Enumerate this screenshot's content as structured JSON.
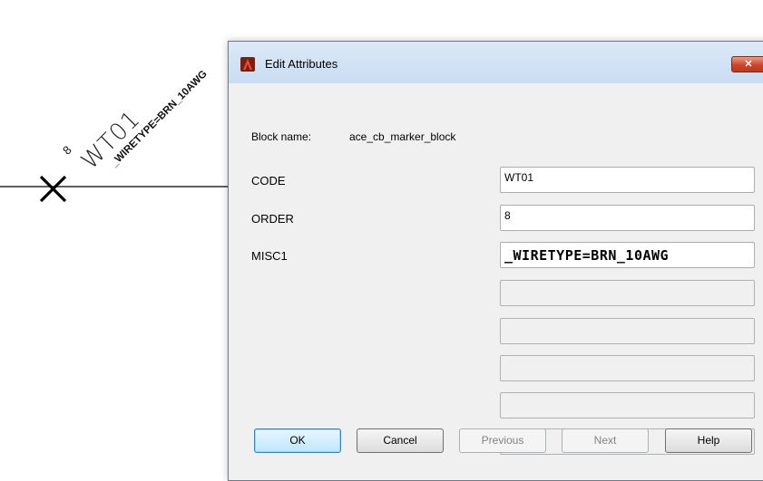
{
  "drawing": {
    "order_text": "8",
    "code_text": "WT01",
    "misc_text": "_WIRETYPE=BRN_10AWG"
  },
  "dialog": {
    "title": "Edit Attributes",
    "close_icon": "close-x-icon",
    "close_glyph": "✕",
    "block_name_label": "Block name:",
    "block_name_value": "ace_cb_marker_block",
    "attributes": [
      {
        "label": "CODE",
        "value": "WT01"
      },
      {
        "label": "ORDER",
        "value": "8"
      },
      {
        "label": "MISC1",
        "value": "_WIRETYPE=BRN_10AWG"
      }
    ],
    "buttons": {
      "ok": "OK",
      "cancel": "Cancel",
      "previous": "Previous",
      "next": "Next",
      "help": "Help"
    },
    "colors": {
      "title_icon": "#c0392b",
      "close_button": "#c9452b"
    }
  }
}
